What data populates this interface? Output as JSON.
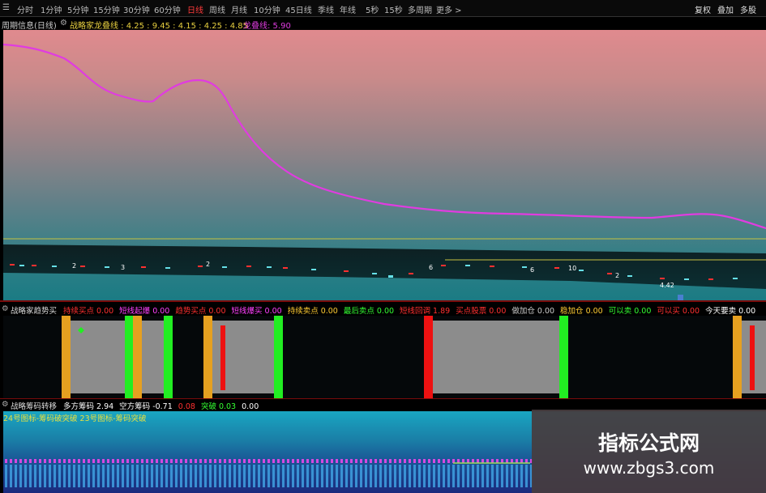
{
  "toolbar": {
    "items": [
      "分时",
      "1分钟",
      "5分钟",
      "15分钟",
      "30分钟",
      "60分钟",
      "日线",
      "周线",
      "月线",
      "10分钟",
      "45日线",
      "季线",
      "年线",
      "5秒",
      "15秒",
      "多周期",
      "更多 >"
    ],
    "active": "日线",
    "right": [
      "复权",
      "叠加",
      "多股"
    ]
  },
  "info_line": {
    "prefix": "周期信息(日线)",
    "indicator": "战略家龙叠线 : 4.25 : 9.45 : 4.15 : 4.25 : 4.85",
    "dragon_label": "龙叠线: 5.90"
  },
  "main_chart": {
    "price_tag": "4.42",
    "dragon_line_color": "#e03ce0",
    "hline_color": "#c8c040"
  },
  "signal_header": {
    "title": "战略家趋势买",
    "items": [
      {
        "label": "持续买点",
        "value": "0.00",
        "color": "#ff3030"
      },
      {
        "label": "短线起爆",
        "value": "0.00",
        "color": "#ff40ff"
      },
      {
        "label": "趋势买点",
        "value": "0.00",
        "color": "#ff3030"
      },
      {
        "label": "短线爆买",
        "value": "0.00",
        "color": "#ff40ff"
      },
      {
        "label": "持续卖点",
        "value": "0.00",
        "color": "#ffcc33"
      },
      {
        "label": "最后卖点",
        "value": "0.00",
        "color": "#33ff33"
      },
      {
        "label": "短线回调",
        "value": "1.89",
        "color": "#ff3030"
      },
      {
        "label": "买点股票",
        "value": "0.00",
        "color": "#ff3030"
      },
      {
        "label": "做加仓",
        "value": "0.00",
        "color": "#cccccc"
      },
      {
        "label": "稳加仓",
        "value": "0.00",
        "color": "#ffcc33"
      },
      {
        "label": "可以卖",
        "value": "0.00",
        "color": "#33ff33"
      },
      {
        "label": "可以买",
        "value": "0.00",
        "color": "#ff3030"
      },
      {
        "label": "今天要卖",
        "value": "0.00",
        "color": "#ffffff"
      }
    ]
  },
  "volume_header": {
    "title": "战略筹码转移",
    "items": [
      {
        "label": "多方筹码",
        "value": "2.94",
        "color": "#ffffff"
      },
      {
        "label": "空方筹码",
        "value": "-0.71",
        "color": "#ffffff"
      },
      {
        "label": "",
        "value": "0.08",
        "color": "#ff3030"
      },
      {
        "label": "突破",
        "value": "0.03",
        "color": "#33ff33"
      },
      {
        "label": "",
        "value": "0.00",
        "color": "#ffffff"
      }
    ],
    "sub_legend": "24号图标-筹码破突破  23号图标-筹码突破"
  },
  "watermark": {
    "title": "指标公式网",
    "url": "www.zbgs3.com"
  },
  "colors": {
    "orange_bar": "#e6a020",
    "green_bar": "#22ee22",
    "red_bar": "#ee1111",
    "gray_fill": "#8c8c8c"
  }
}
